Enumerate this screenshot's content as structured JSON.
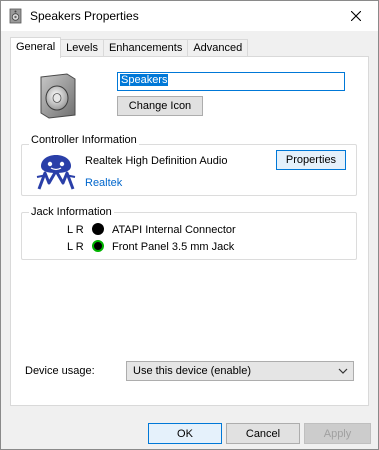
{
  "window": {
    "title": "Speakers Properties"
  },
  "icons": {
    "title": "speaker-icon",
    "close": "close-icon",
    "device": "speaker-icon",
    "controller": "realtek-logo-icon",
    "dropdown": "chevron-down-icon"
  },
  "tabs": [
    {
      "label": "General",
      "active": true
    },
    {
      "label": "Levels",
      "active": false
    },
    {
      "label": "Enhancements",
      "active": false
    },
    {
      "label": "Advanced",
      "active": false
    }
  ],
  "general": {
    "device_name": "Speakers",
    "change_icon_label": "Change Icon",
    "controller": {
      "group_label": "Controller Information",
      "name": "Realtek High Definition Audio",
      "vendor_link": "Realtek",
      "properties_label": "Properties"
    },
    "jack": {
      "group_label": "Jack Information",
      "items": [
        {
          "channels": "L R",
          "color": "#000000",
          "label": "ATAPI Internal Connector"
        },
        {
          "channels": "L R",
          "color": "#000000",
          "ring": "#00b400",
          "label": "Front Panel 3.5 mm Jack"
        }
      ]
    },
    "device_usage": {
      "label": "Device usage:",
      "value": "Use this device (enable)"
    }
  },
  "buttons": {
    "ok": "OK",
    "cancel": "Cancel",
    "apply": "Apply"
  },
  "colors": {
    "accent": "#0078d7",
    "link": "#0066cc",
    "jack_green": "#00b400"
  }
}
